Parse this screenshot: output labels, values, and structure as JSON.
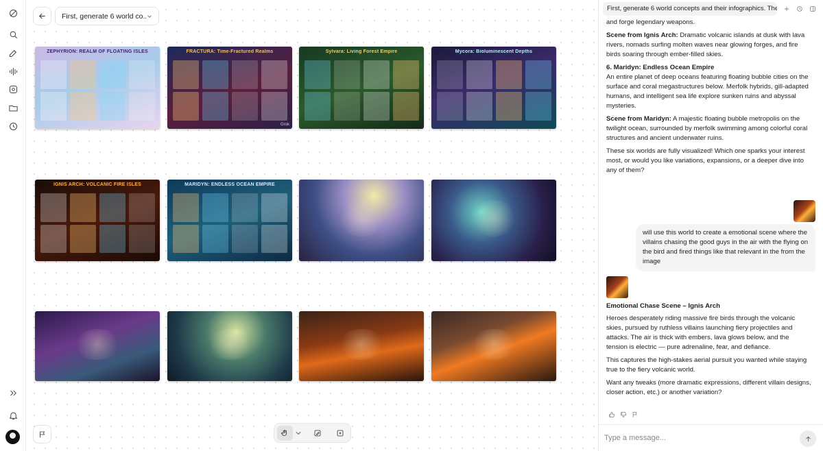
{
  "canvas": {
    "title_select": "First, generate 6 world co...",
    "images": [
      {
        "name": "zephyrion-infographic",
        "label": "ZEPHYRION: REALM OF FLOATING ISLES",
        "label_color": "#3a2a6a",
        "bg": "linear-gradient(160deg,#cdb8e6 0%,#a7cbe9 45%,#e9d4ef 100%)",
        "watermark": ""
      },
      {
        "name": "fractura-infographic",
        "label": "FRACTURA: Time-Fractured Realms",
        "label_color": "#f0c070",
        "bg": "linear-gradient(160deg,#1d2a5a 0%,#5a1f3c 55%,#2b1f4a 100%)",
        "watermark": "Grok"
      },
      {
        "name": "sylvara-infographic",
        "label": "Sylvara: Living Forest Empire",
        "label_color": "#e7d27a",
        "bg": "linear-gradient(160deg,#173a22 0%,#2b5a2b 50%,#142a18 100%)",
        "watermark": ""
      },
      {
        "name": "mycora-infographic",
        "label": "Mycora: Bioluminescent Depths",
        "label_color": "#b8f0ff",
        "bg": "linear-gradient(160deg,#1b1a3c 0%,#3a2a6a 45%,#0f4a55 100%)",
        "watermark": ""
      },
      {
        "name": "ignis-arch-infographic",
        "label": "IGNIS ARCH: VOLCANIC FIRE ISLES",
        "label_color": "#ffb040",
        "bg": "linear-gradient(160deg,#1a0c08 0%,#4a1a0c 50%,#1a0a06 100%)",
        "watermark": ""
      },
      {
        "name": "maridyn-infographic",
        "label": "MARIDYN: ENDLESS OCEAN EMPIRE",
        "label_color": "#cfe9ff",
        "bg": "linear-gradient(160deg,#0f3a5a 0%,#1f5f7a 50%,#0c2a44 100%)",
        "watermark": ""
      },
      {
        "name": "zephyrion-scene",
        "label": "",
        "label_color": "",
        "bg": "radial-gradient(circle at 60% 20%,#f4e9a6 0%,#9c8fc5 30%,#3d4f86 60%,#2a2240 100%)",
        "watermark": ""
      },
      {
        "name": "mycora-scene",
        "label": "",
        "label_color": "",
        "bg": "radial-gradient(circle at 40% 40%,#6fd6c8 0%,#3a5a8a 35%,#2a1f4a 70%,#120f22 100%)",
        "watermark": ""
      },
      {
        "name": "fractura-scene",
        "label": "",
        "label_color": "",
        "bg": "linear-gradient(160deg,#2a1a4a 0%,#6a3a8a 40%,#3a5a7a 70%,#1a1428 100%)",
        "watermark": ""
      },
      {
        "name": "sylvara-scene",
        "label": "",
        "label_color": "",
        "bg": "radial-gradient(circle at 55% 30%,#d8e6a0 0%,#4a7a6a 35%,#1f3a4a 70%,#0e1a24 100%)",
        "watermark": ""
      },
      {
        "name": "ignis-arch-scene",
        "label": "",
        "label_color": "",
        "bg": "linear-gradient(170deg,#3a2418 0%,#8a3a14 40%,#e06a1a 60%,#2a140c 100%)",
        "watermark": ""
      },
      {
        "name": "ignis-arch-chase-scene",
        "label": "",
        "label_color": "",
        "bg": "linear-gradient(160deg,#3a2a24 0%,#7a4a30 35%,#f07a22 55%,#2a1810 100%)",
        "watermark": ""
      }
    ]
  },
  "toolbar": {
    "flag_title": "Flag"
  },
  "chat": {
    "tab_title": "First, generate 6 world concepts and their infographics. The",
    "p1": "and forge legendary weapons.",
    "p2_bold": "Scene from Ignis Arch:",
    "p2_text": " Dramatic volcanic islands at dusk with lava rivers, nomads surfing molten waves near glowing forges, and fire birds soaring through ember-filled skies.",
    "h6": "6. Maridyn: Endless Ocean Empire",
    "p3": "An entire planet of deep oceans featuring floating bubble cities on the surface and coral megastructures below. Merfolk hybrids, gill-adapted humans, and intelligent sea life explore sunken ruins and abyssal mysteries.",
    "p4_bold": "Scene from Maridyn:",
    "p4_text": " A majestic floating bubble metropolis on the twilight ocean, surrounded by merfolk swimming among colorful coral structures and ancient underwater ruins.",
    "p5": "These six worlds are fully visualized! Which one sparks your interest most, or would you like variations, expansions, or a deeper dive into any of them?",
    "user_msg": "will use this world to create a emotional scene where the villains chasing the good guys in the air with the flying on the bird and fired things like that relevant in the from the image",
    "reply_title": "Emotional Chase Scene – Ignis Arch",
    "reply_p1": "Heroes desperately riding massive fire birds through the volcanic skies, pursued by ruthless villains launching fiery projectiles and attacks. The air is thick with embers, lava glows below, and the tension is electric — pure adrenaline, fear, and defiance.",
    "reply_p2": "This captures the high-stakes aerial pursuit you wanted while staying true to the fiery volcanic world.",
    "reply_p3": "Want any tweaks (more dramatic expressions, different villain designs, closer action, etc.) or another variation?",
    "input_placeholder": "Type a message..."
  }
}
